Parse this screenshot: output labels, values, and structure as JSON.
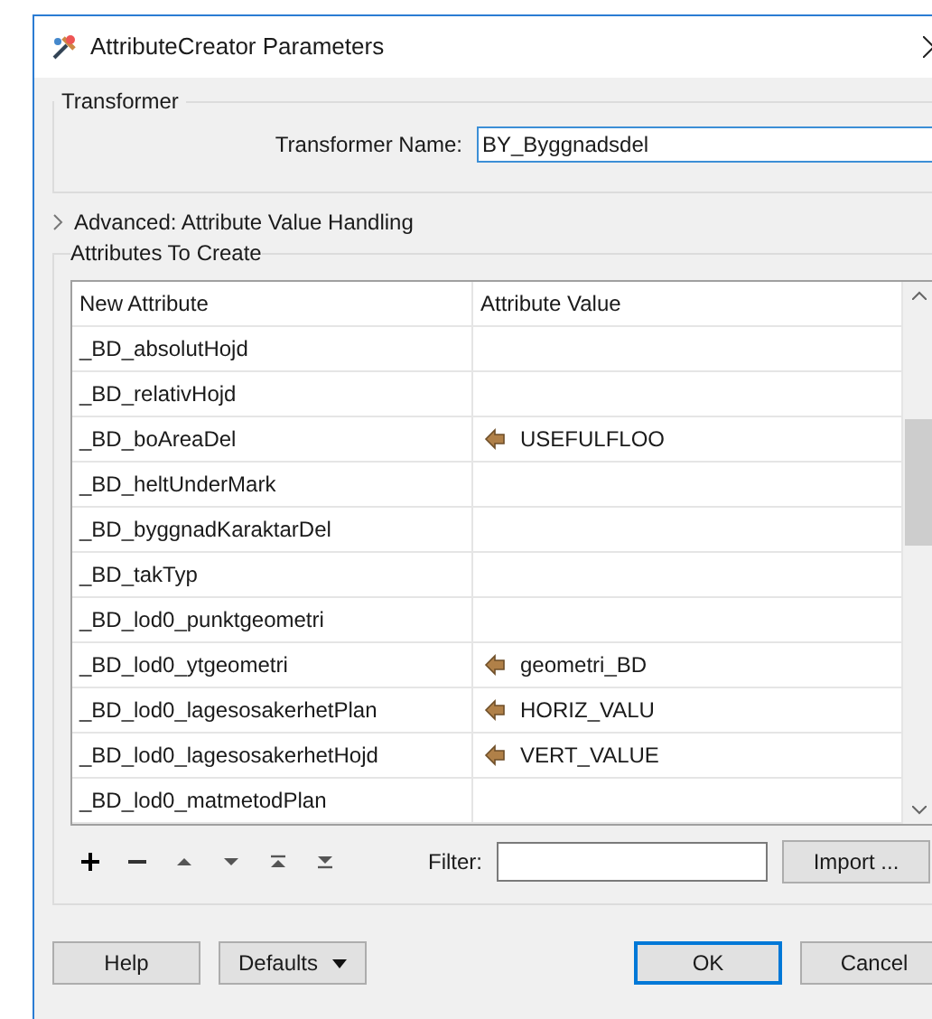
{
  "window": {
    "title": "AttributeCreator Parameters"
  },
  "transformer": {
    "group_title": "Transformer",
    "name_label": "Transformer Name:",
    "name_value": "BY_Byggnadsdel"
  },
  "advanced": {
    "label": "Advanced: Attribute Value Handling",
    "expanded": false
  },
  "attributes": {
    "group_title": "Attributes To Create",
    "columns": [
      "New Attribute",
      "Attribute Value"
    ],
    "rows": [
      {
        "name": "_BD_absolutHojd",
        "kind": "empty"
      },
      {
        "name": "_BD_relativHojd",
        "kind": "empty"
      },
      {
        "name": "_BD_boAreaDel",
        "value": "USEFULFLOO",
        "kind": "attribute"
      },
      {
        "name": "_BD_heltUnderMark",
        "kind": "empty"
      },
      {
        "name": "_BD_byggnadKaraktarDel",
        "kind": "empty"
      },
      {
        "name": "_BD_takTyp",
        "kind": "empty"
      },
      {
        "name": "_BD_lod0_punktgeometri",
        "kind": "empty"
      },
      {
        "name": "_BD_lod0_ytgeometri",
        "value": "geometri_BD",
        "kind": "attribute"
      },
      {
        "name": "_BD_lod0_lagesosakerhetPlan",
        "value": "HORIZ_VALU",
        "kind": "attribute"
      },
      {
        "name": "_BD_lod0_lagesosakerhetHojd",
        "value": "VERT_VALUE",
        "kind": "attribute"
      },
      {
        "name": "_BD_lod0_matmetodPlan",
        "kind": "empty"
      }
    ],
    "filter_label": "Filter:",
    "import_button": "Import ..."
  },
  "buttons": [
    {
      "label": "Help",
      "kind": "plain",
      "default": false
    },
    {
      "label": "Defaults",
      "kind": "dropdown",
      "default": false
    },
    {
      "label": "OK",
      "kind": "plain",
      "default": true
    },
    {
      "label": "Cancel",
      "kind": "plain",
      "default": false
    }
  ]
}
